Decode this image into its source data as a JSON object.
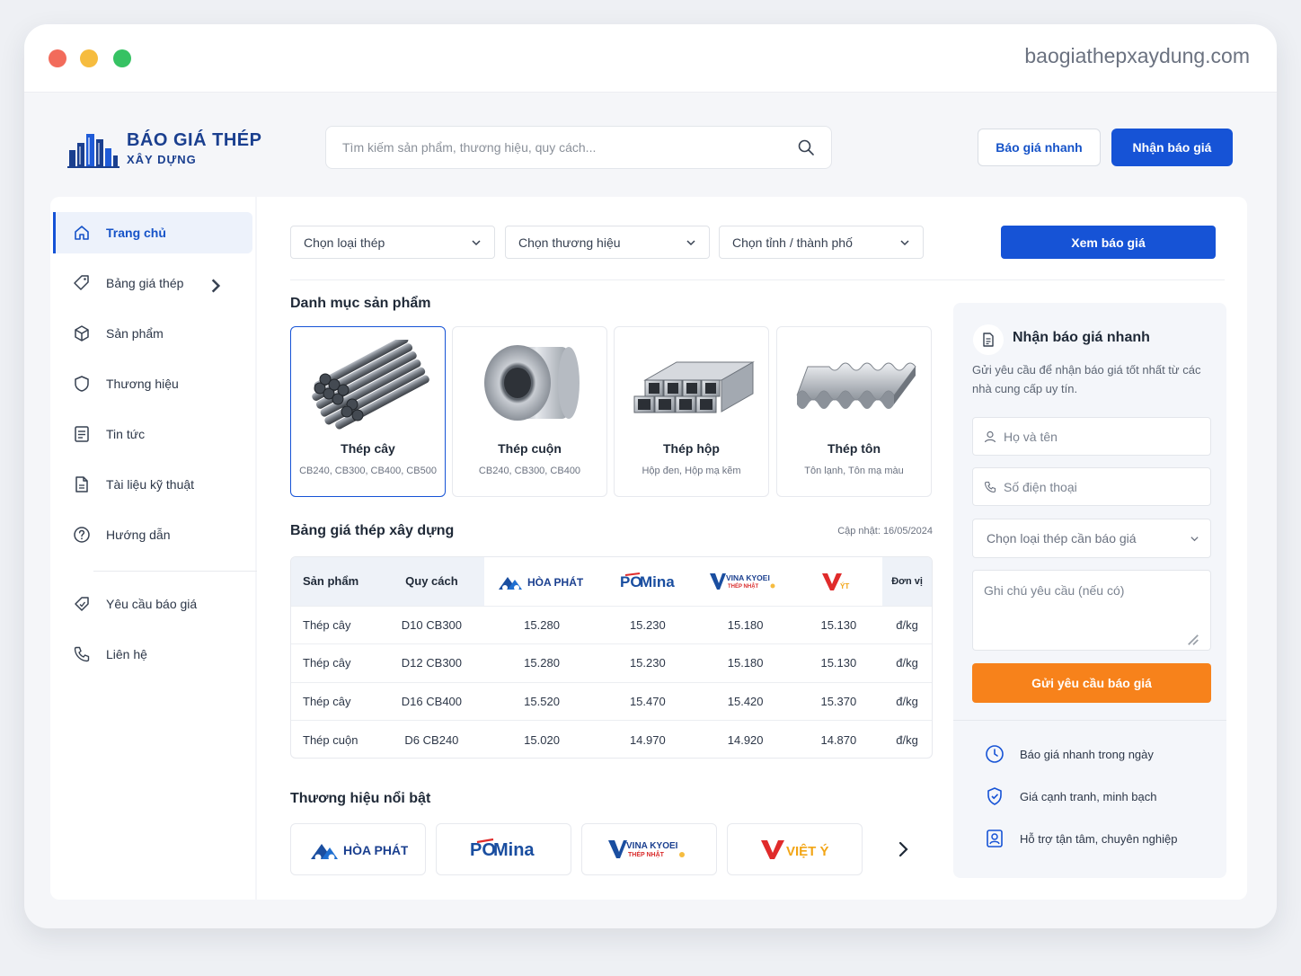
{
  "browser": {
    "url": "baogiathepxaydung.com"
  },
  "logo": {
    "line1": "BÁO GIÁ THÉP",
    "line2": "XÂY DỰNG"
  },
  "search": {
    "placeholder": "Tìm kiếm sản phẩm, thương hiệu, quy cách..."
  },
  "header": {
    "quick_quote": "Báo giá nhanh",
    "get_quote": "Nhận báo giá"
  },
  "sidebar": {
    "items": [
      {
        "label": "Trang chủ",
        "icon": "home-icon"
      },
      {
        "label": "Bảng giá thép",
        "icon": "price-tag-icon"
      },
      {
        "label": "Sản phẩm",
        "icon": "box-icon"
      },
      {
        "label": "Thương hiệu",
        "icon": "shield-icon"
      },
      {
        "label": "Tin tức",
        "icon": "news-icon"
      },
      {
        "label": "Tài liệu kỹ thuật",
        "icon": "document-icon"
      },
      {
        "label": "Hướng dẫn",
        "icon": "help-icon"
      },
      {
        "label": "Yêu cầu báo giá",
        "icon": "quote-request-icon"
      },
      {
        "label": "Liên hệ",
        "icon": "phone-icon"
      }
    ]
  },
  "filters": {
    "steel_type": "Chọn loại thép",
    "brand": "Chọn thương hiệu",
    "city": "Chọn tỉnh / thành phố",
    "view_button": "Xem báo giá"
  },
  "categories": {
    "title": "Danh mục sản phẩm",
    "items": [
      {
        "name": "Thép cây",
        "spec": "CB240, CB300, CB400, CB500"
      },
      {
        "name": "Thép cuộn",
        "spec": "CB240, CB300, CB400"
      },
      {
        "name": "Thép hộp",
        "spec": "Hộp đen, Hộp mạ kẽm"
      },
      {
        "name": "Thép tôn",
        "spec": "Tôn lạnh, Tôn mạ màu"
      }
    ]
  },
  "price_table": {
    "title": "Bảng giá thép xây dựng",
    "updated": "Cập nhật: 16/05/2024",
    "headers": {
      "product": "Sản phẩm",
      "spec": "Quy cách",
      "unit": "Đơn vị"
    },
    "brands": [
      "HÒA PHÁT",
      "POMina",
      "VINA KYOEI",
      "VIỆT Ý"
    ],
    "rows": [
      {
        "product": "Thép cây",
        "spec": "D10 CB300",
        "p1": "15.280",
        "p2": "15.230",
        "p3": "15.180",
        "p4": "15.130",
        "unit": "đ/kg"
      },
      {
        "product": "Thép cây",
        "spec": "D12 CB300",
        "p1": "15.280",
        "p2": "15.230",
        "p3": "15.180",
        "p4": "15.130",
        "unit": "đ/kg"
      },
      {
        "product": "Thép cây",
        "spec": "D16 CB400",
        "p1": "15.520",
        "p2": "15.470",
        "p3": "15.420",
        "p4": "15.370",
        "unit": "đ/kg"
      },
      {
        "product": "Thép cuộn",
        "spec": "D6 CB240",
        "p1": "15.020",
        "p2": "14.970",
        "p3": "14.920",
        "p4": "14.870",
        "unit": "đ/kg"
      }
    ]
  },
  "featured_brands": {
    "title": "Thương hiệu nổi bật"
  },
  "brand_logos": {
    "hoaphat": "HÒA PHÁT",
    "pomina_po": "PO",
    "pomina_mina": "Mina",
    "vinakyoei": "VINA KYOEI",
    "vinakyoei_sub": "THÉP NHẬT",
    "vietnam_y": "VIỆT Ý"
  },
  "quote_panel": {
    "title": "Nhận báo giá nhanh",
    "description": "Gửi yêu cầu để nhận báo giá tốt nhất từ các nhà cung cấp uy tín.",
    "name_placeholder": "Họ và tên",
    "phone_placeholder": "Số điện thoại",
    "steel_select": "Chọn loại thép cần báo giá",
    "note_placeholder": "Ghi chú yêu cầu (nếu có)",
    "submit": "Gửi yêu cầu báo giá",
    "features": [
      "Báo giá nhanh trong ngày",
      "Giá cạnh tranh, minh bạch",
      "Hỗ trợ tận tâm, chuyên nghiệp"
    ]
  },
  "colors": {
    "primary": "#1653d6",
    "accent_orange": "#f7821b",
    "brand_navy": "#1a3f8f"
  }
}
